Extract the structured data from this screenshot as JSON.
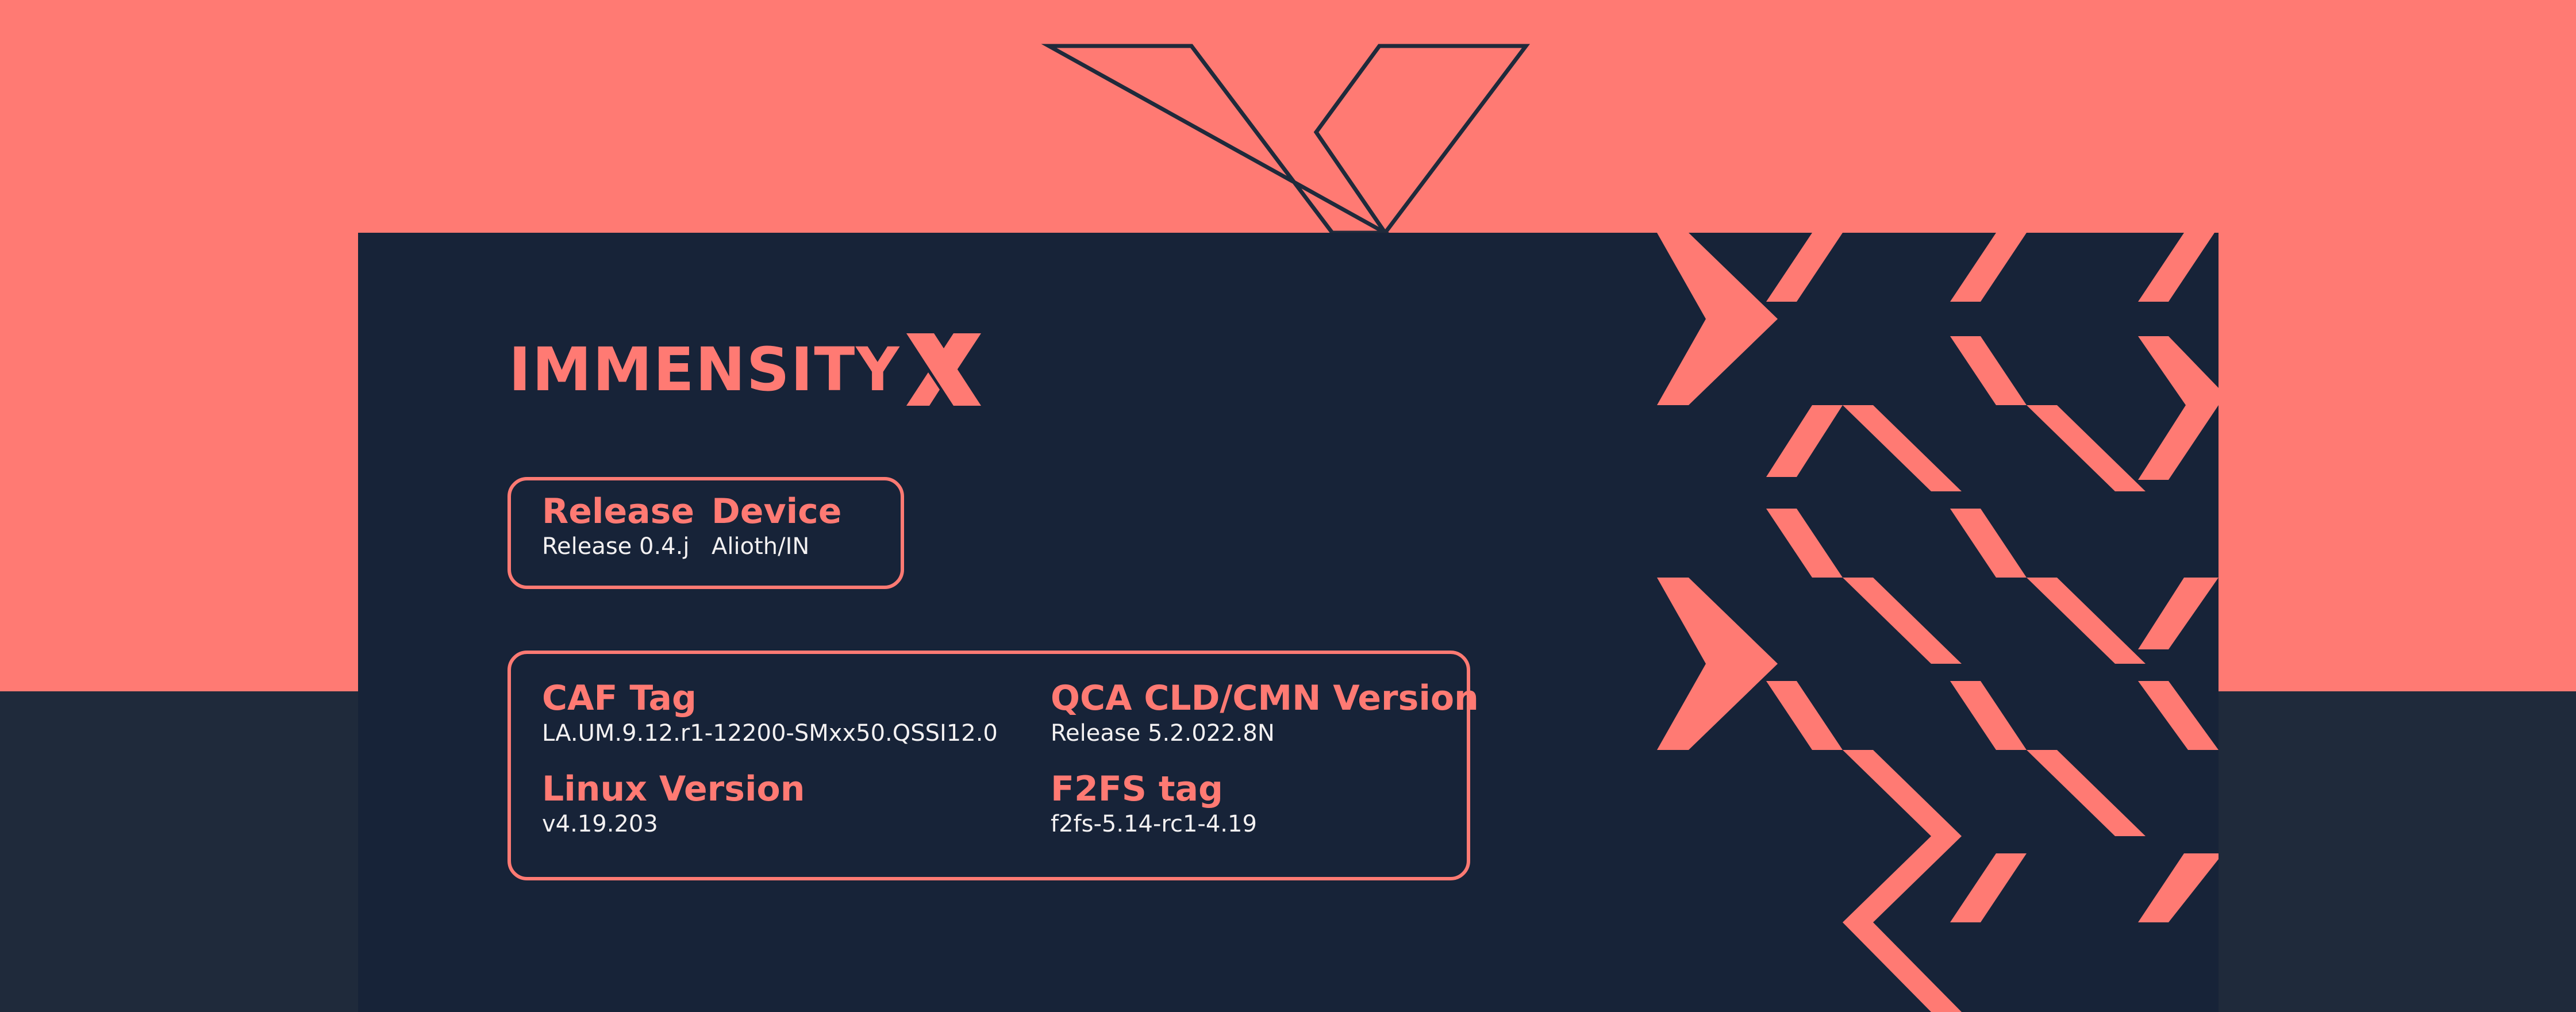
{
  "brand": {
    "name": "IMMENSITY",
    "mark_icon": "x-logo-icon"
  },
  "colors": {
    "coral": "#ff7a73",
    "navy": "#172338",
    "dark": "#1f2a3b",
    "text": "#f3f1f2"
  },
  "release_box": {
    "release": {
      "label": "Release",
      "value": "Release 0.4.j"
    },
    "device": {
      "label": "Device",
      "value": "Alioth/IN"
    }
  },
  "details_box": {
    "caf_tag": {
      "label": "CAF Tag",
      "value": "LA.UM.9.12.r1-12200-SMxx50.QSSI12.0"
    },
    "qca_version": {
      "label": "QCA CLD/CMN Version",
      "value": "Release 5.2.022.8N"
    },
    "linux_version": {
      "label": "Linux Version",
      "value": "v4.19.203"
    },
    "f2fs_tag": {
      "label": "F2FS tag",
      "value": "f2fs-5.14-rc1-4.19"
    }
  }
}
